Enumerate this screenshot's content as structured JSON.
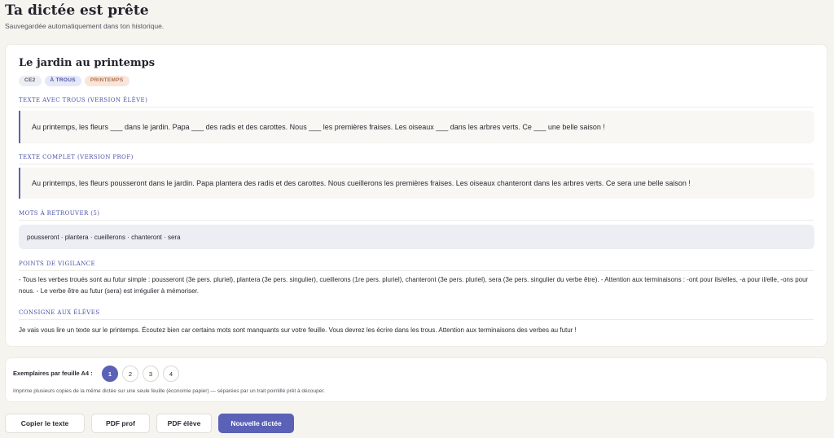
{
  "header": {
    "title": "Ta dictée est prête",
    "subtitle": "Sauvegardée automatiquement dans ton historique."
  },
  "dictation": {
    "title": "Le jardin au printemps",
    "tags": {
      "level": "CE2",
      "type": "À TROUS",
      "theme": "PRINTEMPS"
    },
    "student_section": {
      "label": "TEXTE AVEC TROUS (VERSION ÉLÈVE)",
      "text": "Au printemps, les fleurs ___ dans le jardin. Papa ___ des radis et des carottes. Nous ___ les premières fraises. Les oiseaux ___ dans les arbres verts. Ce ___ une belle saison !"
    },
    "teacher_section": {
      "label": "TEXTE COMPLET (VERSION PROF)",
      "text": "Au printemps, les fleurs pousseront dans le jardin. Papa plantera des radis et des carottes. Nous cueillerons les premières fraises. Les oiseaux chanteront dans les arbres verts. Ce sera une belle saison !"
    },
    "words_section": {
      "label": "MOTS À RETROUVER (5)",
      "text": "pousseront · plantera · cueillerons · chanteront · sera"
    },
    "vigilance_section": {
      "label": "POINTS DE VIGILANCE",
      "text": "- Tous les verbes troués sont au futur simple : pousseront (3e pers. pluriel), plantera (3e pers. singulier), cueillerons (1re pers. pluriel), chanteront (3e pers. pluriel), sera (3e pers. singulier du verbe être). - Attention aux terminaisons : -ont pour ils/elles, -a pour il/elle, -ons pour nous. - Le verbe être au futur (sera) est irrégulier à mémoriser."
    },
    "instruction_section": {
      "label": "CONSIGNE AUX ÉLÈVES",
      "text": "Je vais vous lire un texte sur le printemps. Écoutez bien car certains mots sont manquants sur votre feuille. Vous devrez les écrire dans les trous. Attention aux terminaisons des verbes au futur !"
    }
  },
  "copies": {
    "label": "Exemplaires par feuille A4 :",
    "options": [
      "1",
      "2",
      "3",
      "4"
    ],
    "selected": "1",
    "note": "Imprime plusieurs copies de la même dictée sur une seule feuille (économie papier) — séparées par un trait pointillé prêt à découper."
  },
  "actions": {
    "copy_label": "Copier le texte",
    "pdf_teacher_label": "PDF prof",
    "pdf_student_label": "PDF élève",
    "new_label": "Nouvelle dictée"
  },
  "colors": {
    "accent": "#5a61b6",
    "background": "#f6f4ef",
    "tag_theme": "#f8e6dc"
  }
}
